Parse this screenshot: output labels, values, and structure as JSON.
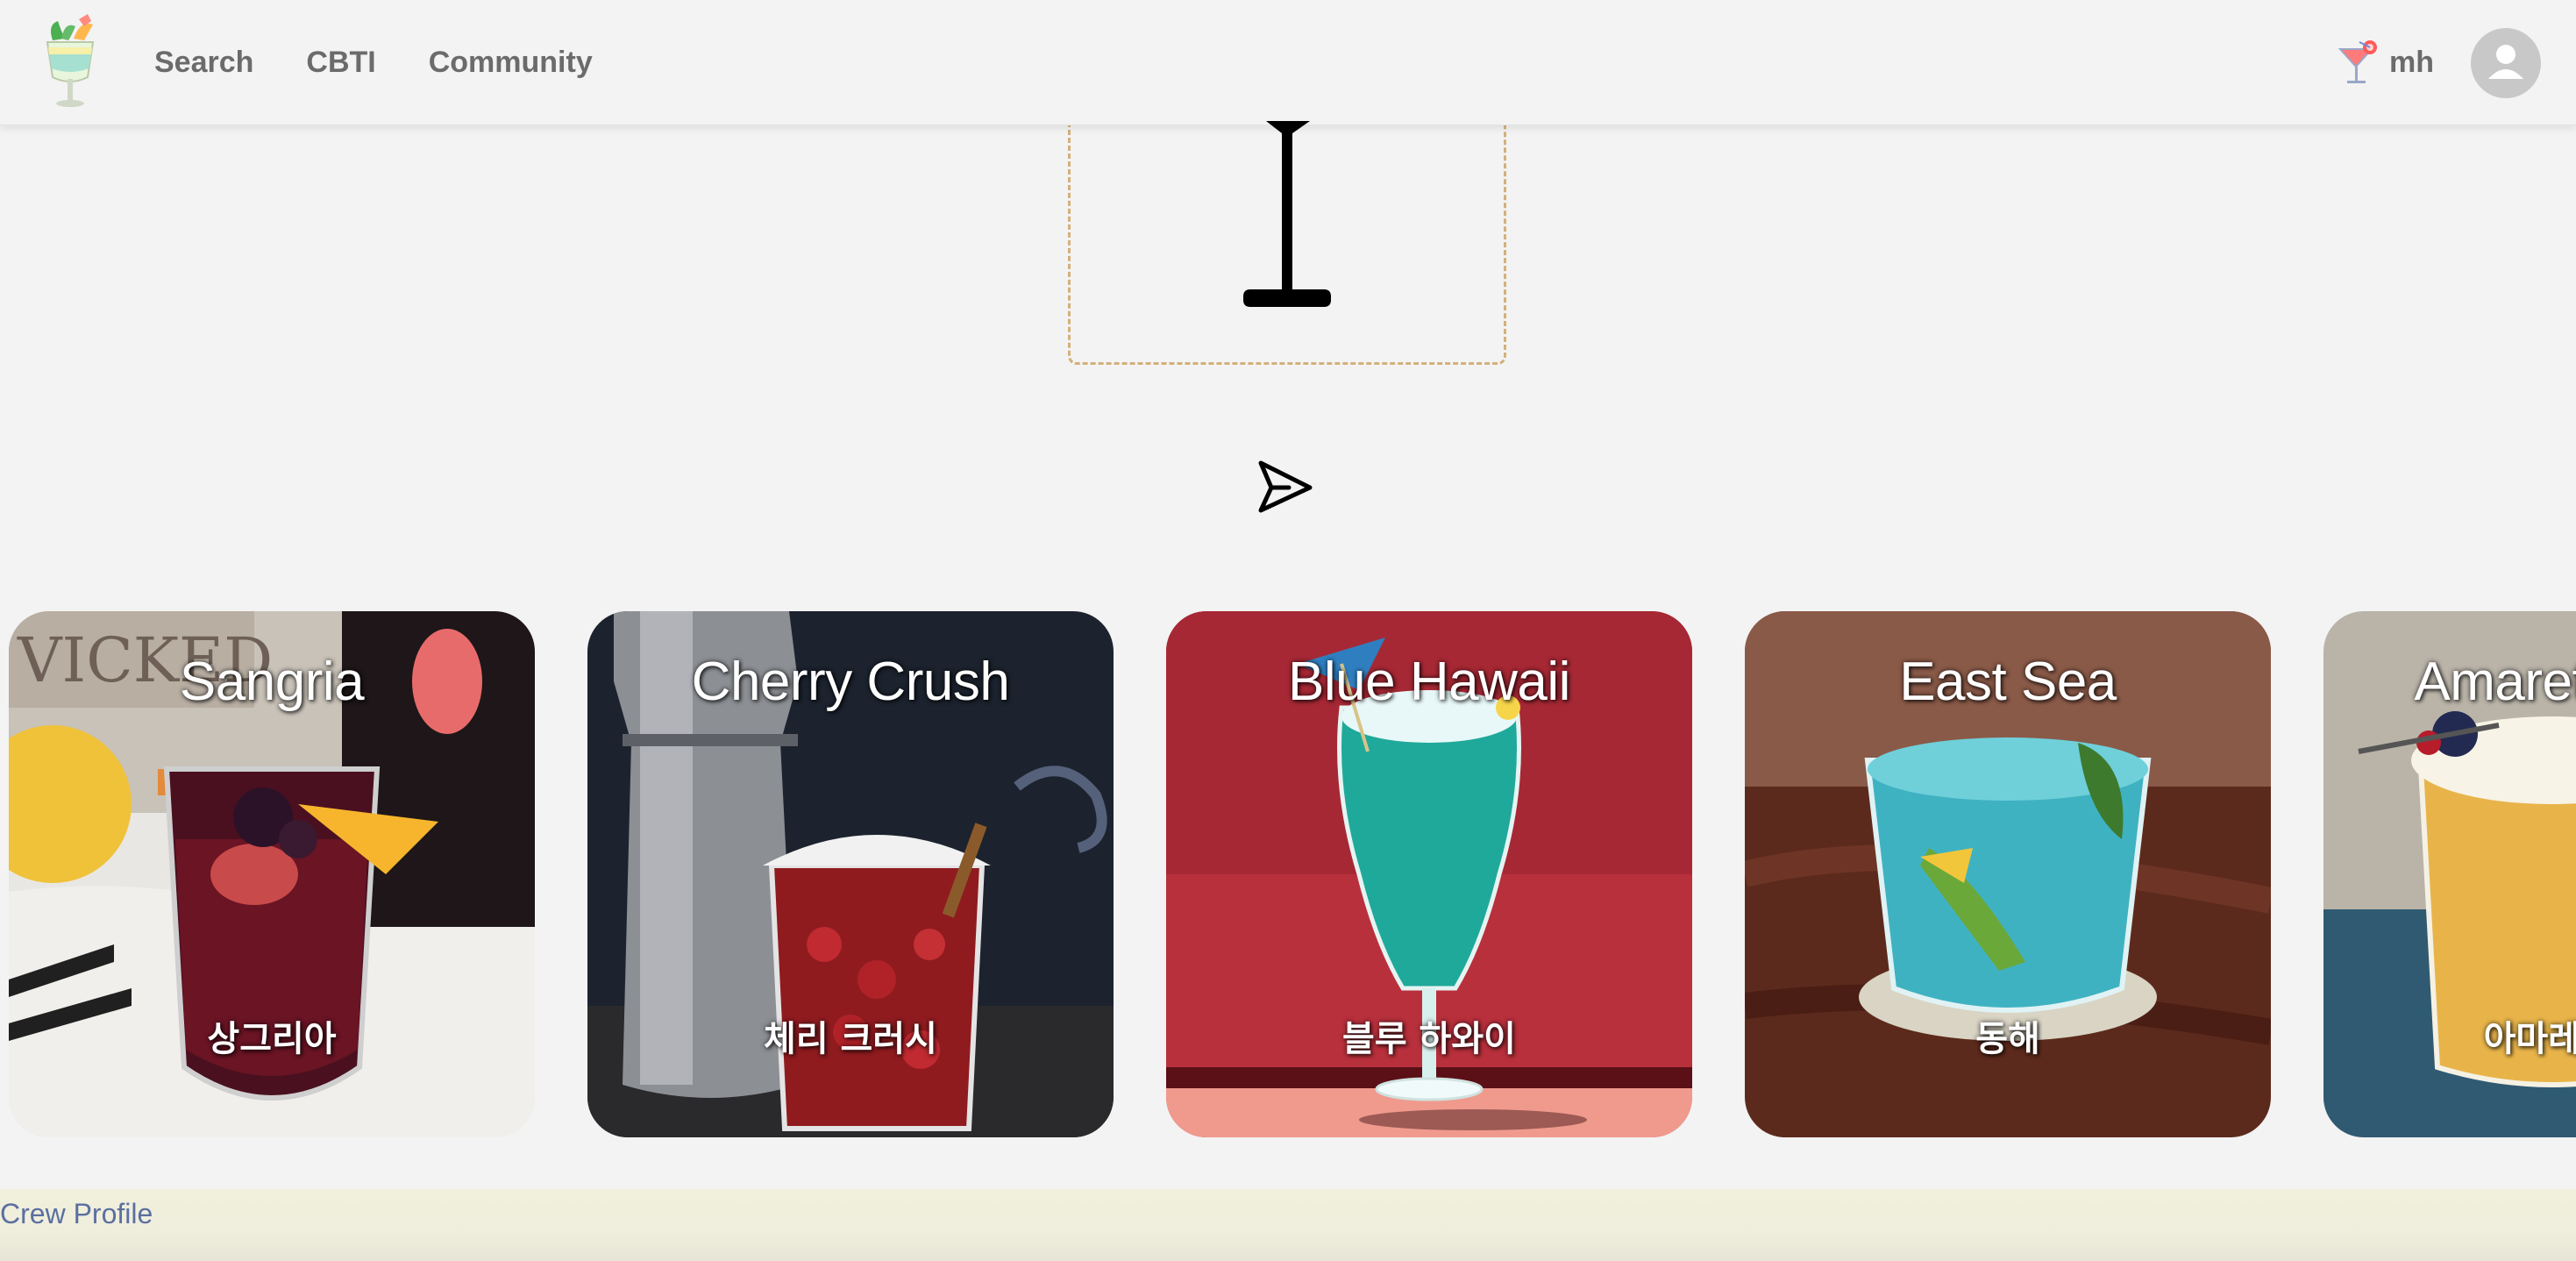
{
  "header": {
    "nav": [
      "Search",
      "CBTI",
      "Community"
    ],
    "username": "mh"
  },
  "cards": [
    {
      "title": "Sangria",
      "subtitle": "상그리아"
    },
    {
      "title": "Cherry Crush",
      "subtitle": "체리 크러시"
    },
    {
      "title": "Blue Hawaii",
      "subtitle": "블루 하와이"
    },
    {
      "title": "East Sea",
      "subtitle": "동해"
    },
    {
      "title": "Amaretto Sour",
      "subtitle": "아마레또 사워"
    }
  ],
  "footer": {
    "link": "Crew Profile"
  },
  "colors": {
    "background": "#f3f3f3",
    "nav_text": "#6b6b6b",
    "dashed_border": "#d3b07a",
    "footer_bg": "#f1f0dc",
    "footer_link": "#5b6fa0"
  },
  "icons": [
    "logo-icon",
    "cocktail-icon",
    "avatar-icon",
    "text-cursor-icon",
    "send-icon"
  ]
}
